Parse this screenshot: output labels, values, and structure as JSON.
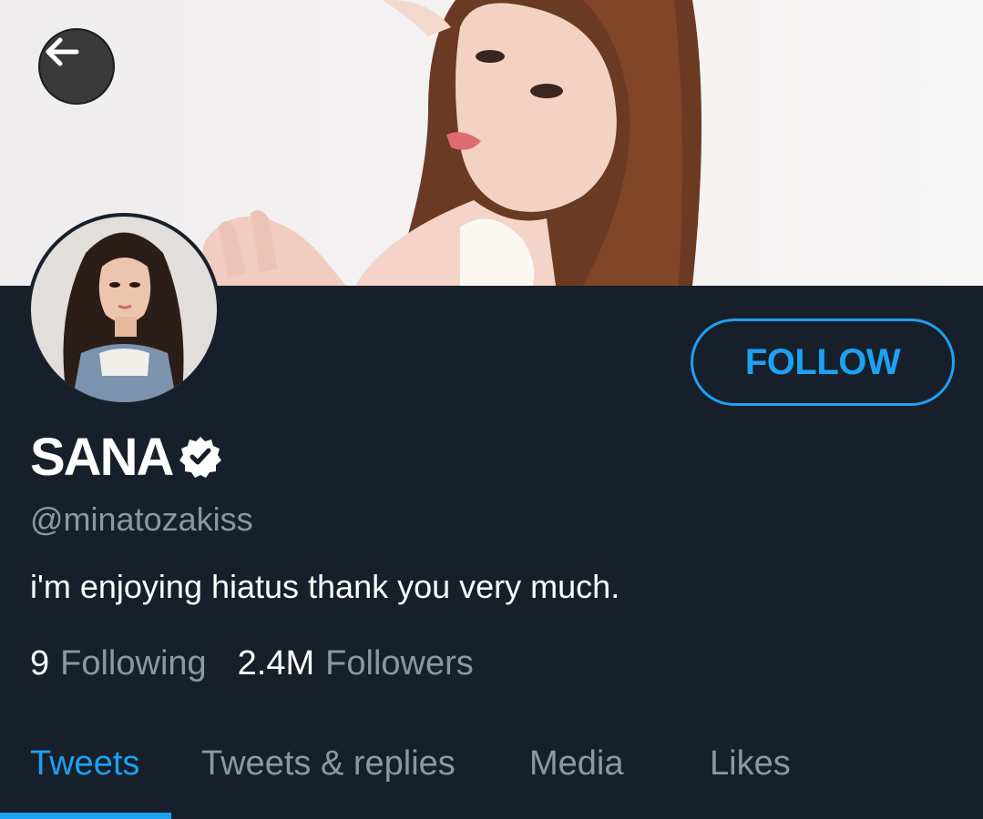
{
  "profile": {
    "display_name": "SANA",
    "handle": "@minatozakiss",
    "bio": "i'm enjoying hiatus thank you very much.",
    "verified": true
  },
  "actions": {
    "follow_label": "FOLLOW"
  },
  "stats": {
    "following_count": "9",
    "following_label": "Following",
    "followers_count": "2.4M",
    "followers_label": "Followers"
  },
  "tabs": [
    {
      "label": "Tweets",
      "active": true
    },
    {
      "label": "Tweets & replies",
      "active": false
    },
    {
      "label": "Media",
      "active": false
    },
    {
      "label": "Likes",
      "active": false
    }
  ],
  "icons": {
    "back": "arrow-left-icon",
    "verified": "verified-badge-icon"
  },
  "colors": {
    "background": "#17202a",
    "accent": "#1da1f2",
    "secondary_text": "#8899a6",
    "primary_text": "#ffffff"
  }
}
